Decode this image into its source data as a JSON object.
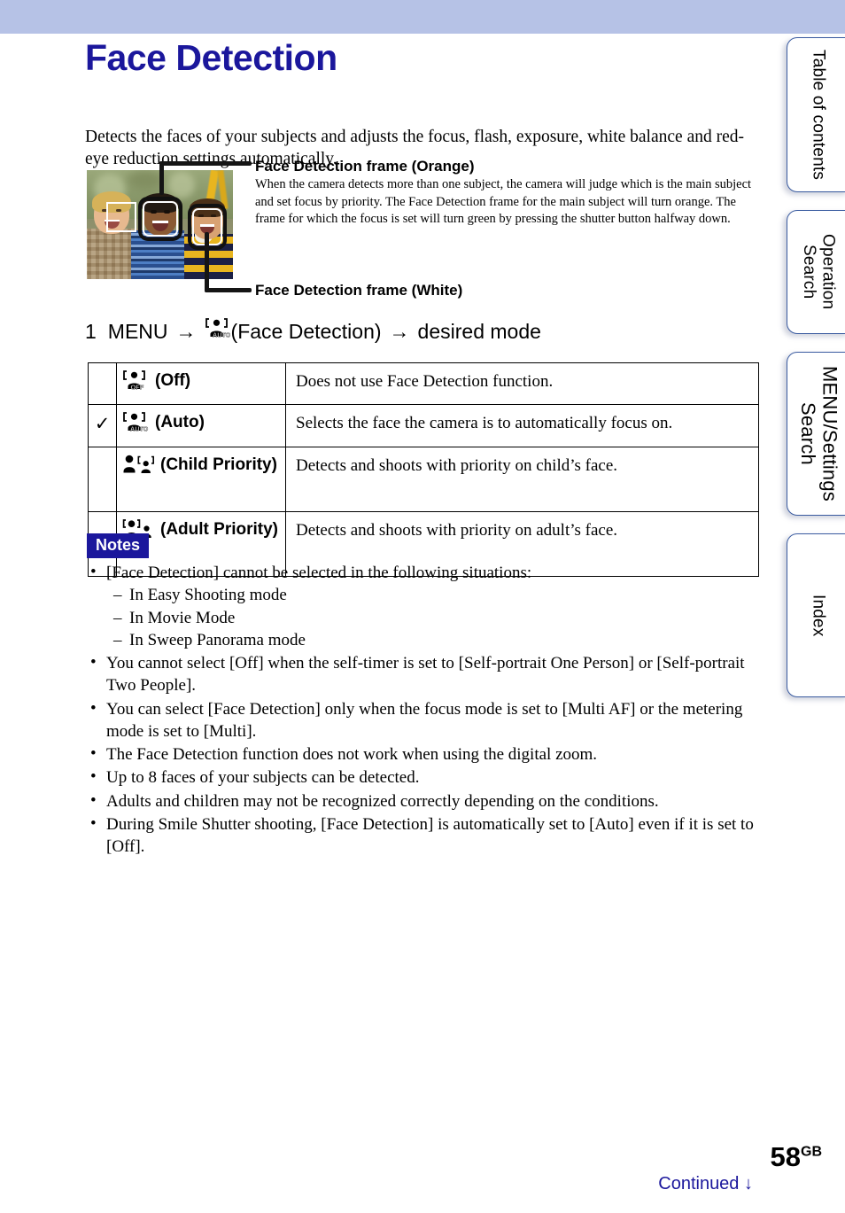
{
  "document": {
    "title": "Face Detection",
    "page_number": "58",
    "page_suffix": "GB",
    "continued_label": "Continued",
    "continued_icon": "down-arrow-icon"
  },
  "intro": {
    "paragraph": "Detects the faces of your subjects and adjusts the focus, flash, exposure, white balance and red-eye reduction settings automatically."
  },
  "figure": {
    "photo_alt": "Three children photographed in a park with face detection frames overlaid",
    "orange_callout": {
      "title": "Face Detection frame (Orange)",
      "body": "When the camera detects more than one subject, the camera will judge which is the main subject and set focus by priority. The Face Detection frame for the main subject will turn orange. The frame for which the focus is set will turn green by pressing the shutter button halfway down."
    },
    "white_callout": {
      "title": "Face Detection frame (White)"
    }
  },
  "step": {
    "number": "1",
    "menu_label": "MENU",
    "arrow": "→",
    "icon": "face-detection-auto-icon",
    "function_label": "(Face Detection)",
    "target_label": "desired mode"
  },
  "table": {
    "rows": [
      {
        "selected": false,
        "check": "",
        "icon": "face-detection-off-icon",
        "label": "(Off)",
        "description": "Does not use Face Detection function."
      },
      {
        "selected": true,
        "check": "✓",
        "icon": "face-detection-auto-icon",
        "label": "(Auto)",
        "description": "Selects the face the camera is to automatically focus on."
      },
      {
        "selected": false,
        "check": "",
        "icon": "face-detection-child-priority-icon",
        "label": "(Child Priority)",
        "description": "Detects and shoots with priority on child’s face."
      },
      {
        "selected": false,
        "check": "",
        "icon": "face-detection-adult-priority-icon",
        "label": "(Adult Priority)",
        "description": "Detects and shoots with priority on adult’s face."
      }
    ]
  },
  "notes": {
    "badge": "Notes",
    "items": [
      {
        "text": "[Face Detection] cannot be selected in the following situations:",
        "sub": [
          "In Easy Shooting mode",
          "In Movie Mode",
          "In Sweep Panorama mode"
        ]
      },
      {
        "text": "You cannot select [Off] when the self-timer is set to [Self-portrait One Person] or [Self-portrait Two People].",
        "sub": []
      },
      {
        "text": "You can select [Face Detection] only when the focus mode is set to [Multi AF] or the metering mode is set to [Multi].",
        "sub": []
      },
      {
        "text": "The Face Detection function does not work when using the digital zoom.",
        "sub": []
      },
      {
        "text": "Up to 8 faces of your subjects can be detected.",
        "sub": []
      },
      {
        "text": "Adults and children may not be recognized correctly depending on the conditions.",
        "sub": []
      },
      {
        "text": "During Smile Shutter shooting, [Face Detection] is automatically set to [Auto] even if it is set to [Off].",
        "sub": []
      }
    ]
  },
  "sidebar": {
    "tabs": [
      {
        "label": "Table of contents",
        "active": false
      },
      {
        "label": "Operation Search",
        "active": false
      },
      {
        "label": "MENU/Settings Search",
        "active": true
      },
      {
        "label": "Index",
        "active": false
      }
    ]
  },
  "colors": {
    "header_band": "#b6c2e6",
    "heading": "#1b179c",
    "notes_badge_bg": "#1b179c",
    "tab_border": "#3a5ba0"
  }
}
